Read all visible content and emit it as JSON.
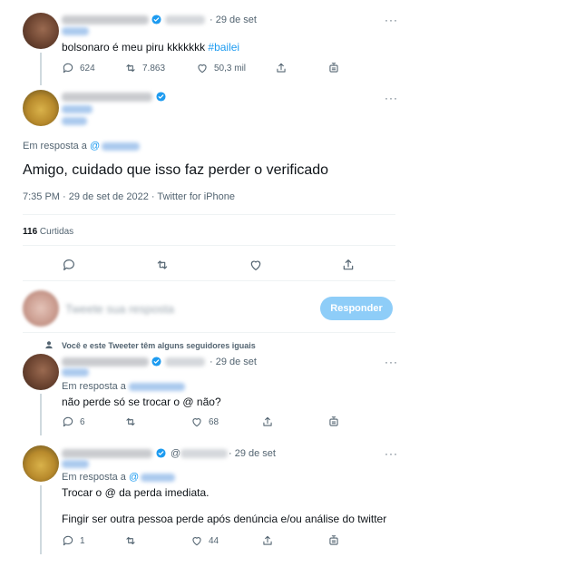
{
  "colors": {
    "accent": "#1d9bf0",
    "muted": "#536471",
    "divider": "#eff3f4",
    "reply_button": "#8ecdf8"
  },
  "tweet1": {
    "date": "· 29 de set",
    "text_main": "bolsonaro é meu piru kkkkkkk ",
    "hashtag": "#bailei",
    "replies": "624",
    "retweets": "7.863",
    "likes": "50,3 mil",
    "more": "···"
  },
  "main_tweet": {
    "replying_label": "Em resposta a ",
    "replying_handle": "@",
    "text": "Amigo, cuidado que isso faz perder o verificado",
    "timestamp": "7:35 PM · 29 de set de 2022 · Twitter for iPhone",
    "likes_count": "116",
    "likes_label": " Curtidas",
    "more": "···"
  },
  "compose": {
    "placeholder": "Tweete sua resposta",
    "reply_button": "Responder"
  },
  "shared_followers": {
    "text": "Você e este Tweeter têm alguns seguidores iguais"
  },
  "reply1": {
    "date": "· 29 de set",
    "replying_label": "Em resposta a ",
    "text": "não perde só se trocar o @ não?",
    "replies": "6",
    "likes": "68",
    "more": "···"
  },
  "reply2": {
    "handle_prefix": "@",
    "date": "· 29 de set",
    "replying_label": "Em resposta a ",
    "replying_handle": "@",
    "text_line1": "Trocar o @ da perda imediata.",
    "text_line2": "Fingir ser outra pessoa perde após denúncia e/ou análise do twitter",
    "replies": "1",
    "likes": "44",
    "more": "···"
  }
}
